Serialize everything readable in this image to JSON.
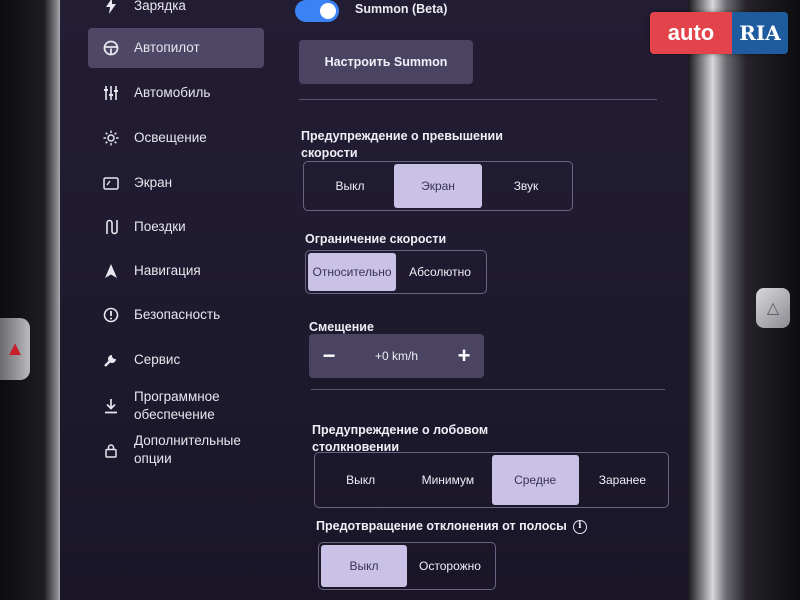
{
  "sidebar": {
    "items": [
      {
        "label": "Зарядка",
        "icon": "lightning-icon"
      },
      {
        "label": "Автопилот",
        "icon": "steering-wheel-icon",
        "active": true
      },
      {
        "label": "Автомобиль",
        "icon": "sliders-icon"
      },
      {
        "label": "Освещение",
        "icon": "sun-icon"
      },
      {
        "label": "Экран",
        "icon": "display-icon"
      },
      {
        "label": "Поездки",
        "icon": "trips-icon"
      },
      {
        "label": "Навигация",
        "icon": "navigation-icon"
      },
      {
        "label": "Безопасность",
        "icon": "safety-icon"
      },
      {
        "label": "Сервис",
        "icon": "wrench-icon"
      },
      {
        "label_line1": "Программное",
        "label_line2": "обеспечение",
        "icon": "download-icon"
      },
      {
        "label_line1": "Дополнительные",
        "label_line2": "опции",
        "icon": "lock-icon"
      }
    ]
  },
  "summon": {
    "toggle_label": "Summon (Beta)",
    "toggle_on": true,
    "configure_button": "Настроить Summon"
  },
  "speed_warning": {
    "title_line1": "Предупреждение о превышении",
    "title_line2": "скорости",
    "options": [
      "Выкл",
      "Экран",
      "Звук"
    ],
    "selected": "Экран"
  },
  "speed_limit": {
    "title": "Ограничение скорости",
    "options": [
      "Относительно",
      "Абсолютно"
    ],
    "selected": "Относительно"
  },
  "offset": {
    "title": "Смещение",
    "minus": "−",
    "value": "+0 km/h",
    "plus": "+"
  },
  "collision_warning": {
    "title_line1": "Предупреждение о лобовом",
    "title_line2": "столкновении",
    "options": [
      "Выкл",
      "Минимум",
      "Средне",
      "Заранее"
    ],
    "selected": "Средне"
  },
  "lane_departure": {
    "title": "Предотвращение отклонения от полосы",
    "options": [
      "Выкл",
      "Осторожно"
    ],
    "selected": "Выкл"
  },
  "watermark": {
    "part1": "auto",
    "part2": "RIA"
  },
  "colors": {
    "accent_toggle": "#3b82f6",
    "selected_segment": "#c9c2e6",
    "active_sidebar": "#4e4766",
    "button_bg": "#4a4462"
  }
}
